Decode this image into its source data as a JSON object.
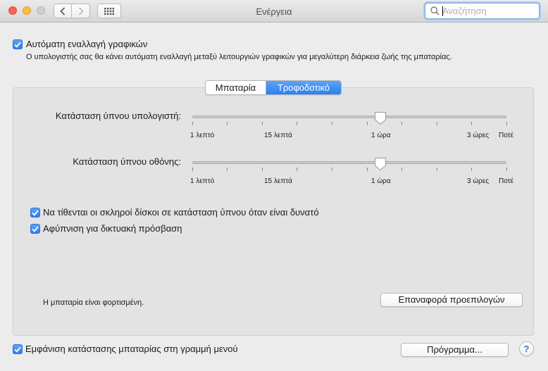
{
  "window": {
    "title": "Ενέργεια",
    "search": {
      "placeholder": "Αναζήτηση",
      "value": ""
    }
  },
  "auto_graphics": {
    "label": "Αυτόματη εναλλαγή γραφικών",
    "checked": true,
    "description": "Ο υπολογιστής σας θα κάνει αυτόματη εναλλαγή μεταξύ λειτουργιών γραφικών για μεγαλύτερη διάρκεια ζωής της μπαταρίας."
  },
  "tabs": [
    {
      "label": "Μπαταρία",
      "selected": false
    },
    {
      "label": "Τροφοδοτικό",
      "selected": true
    }
  ],
  "sliders": [
    {
      "label": "Κατάσταση ύπνου υπολογιστή:",
      "tick_labels": [
        "1 λεπτό",
        "15 λεπτά",
        "1 ώρα",
        "3 ώρες",
        "Ποτέ"
      ],
      "value_label": "1 ώρα"
    },
    {
      "label": "Κατάσταση ύπνου οθόνης:",
      "tick_labels": [
        "1 λεπτό",
        "15 λεπτά",
        "1 ώρα",
        "3 ώρες",
        "Ποτέ"
      ],
      "value_label": "1 ώρα"
    }
  ],
  "options": [
    {
      "label": "Να τίθενται οι σκληροί δίσκοι σε κατάσταση ύπνου όταν είναι δυνατό",
      "checked": true
    },
    {
      "label": "Αφύπνιση για δικτυακή πρόσβαση",
      "checked": true
    }
  ],
  "status": {
    "battery_text": "Η μπαταρία είναι φορτισμένη."
  },
  "buttons": {
    "restore_defaults": "Επαναφορά προεπιλογών",
    "schedule": "Πρόγραμμα...",
    "help": "?"
  },
  "menu_bar_option": {
    "label": "Εμφάνιση κατάστασης μπαταρίας στη γραμμή μενού",
    "checked": true
  },
  "colors": {
    "accent": "#2b7ff0",
    "close": "#fc605c",
    "minimize": "#fdbc40"
  }
}
